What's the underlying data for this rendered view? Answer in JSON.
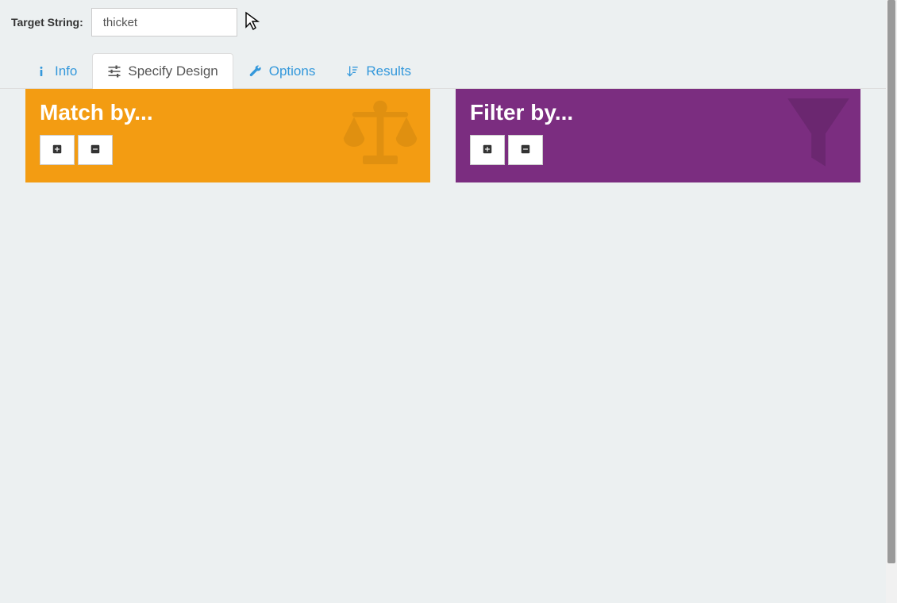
{
  "form": {
    "target_label": "Target String:",
    "target_value": "thicket"
  },
  "tabs": {
    "info": "Info",
    "specify": "Specify Design",
    "options": "Options",
    "results": "Results"
  },
  "panels": {
    "match_title": "Match by...",
    "filter_title": "Filter by..."
  }
}
